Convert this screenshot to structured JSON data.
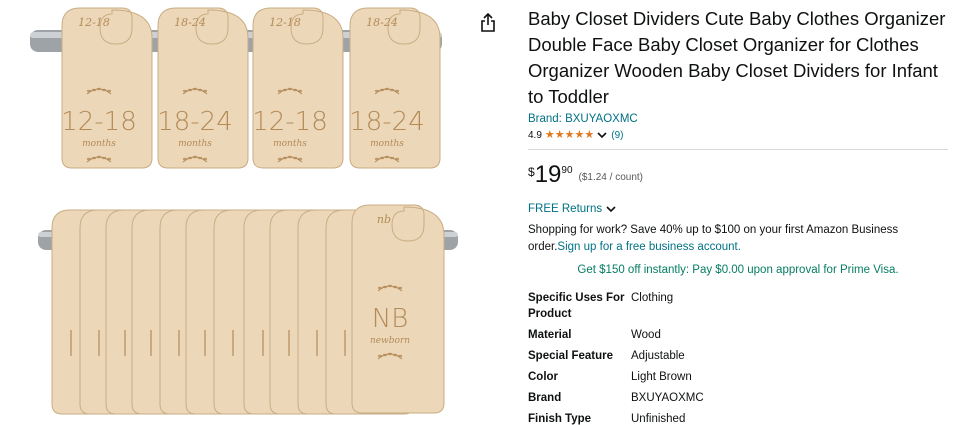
{
  "product": {
    "title": "Baby Closet Dividers Cute Baby Clothes Organizer Double Face Baby Closet Organizer for Clothes Organizer Wooden Baby Closet Dividers for Infant to Toddler",
    "brand": "Brand: BXUYAOXMC",
    "rating": "4.9",
    "stars": 5,
    "review_count": "(9)"
  },
  "image": {
    "top_row": [
      {
        "tab": "12-18",
        "big": "12-18",
        "small": "months"
      },
      {
        "tab": "18-24",
        "big": "18-24",
        "small": "months"
      },
      {
        "tab": "12-18",
        "big": "12-18",
        "small": "months"
      },
      {
        "tab": "18-24",
        "big": "18-24",
        "small": "months"
      }
    ],
    "bottom_front": {
      "tab": "nb",
      "big": "NB",
      "small": "newborn"
    },
    "colors": {
      "wood": "#ecd8b8",
      "wood_edge": "#c9ad84",
      "print": "#b48a58",
      "rod": "#9ea3a8"
    }
  },
  "price": {
    "symbol": "$",
    "whole": "19",
    "fraction": "90",
    "per_unit": "($1.24 / count)"
  },
  "returns": {
    "label": "FREE Returns"
  },
  "business": {
    "text": "Shopping for work? Save 40% up to $100 on your first Amazon Business order.",
    "link": "Sign up for a free business account."
  },
  "promo": {
    "text": "Get $150 off instantly: Pay $0.00 upon approval for Prime Visa."
  },
  "specs": [
    {
      "key": "Specific Uses For Product",
      "value": "Clothing"
    },
    {
      "key": "Material",
      "value": "Wood"
    },
    {
      "key": "Special Feature",
      "value": "Adjustable"
    },
    {
      "key": "Color",
      "value": "Light Brown"
    },
    {
      "key": "Brand",
      "value": "BXUYAOXMC"
    },
    {
      "key": "Finish Type",
      "value": "Unfinished"
    }
  ]
}
